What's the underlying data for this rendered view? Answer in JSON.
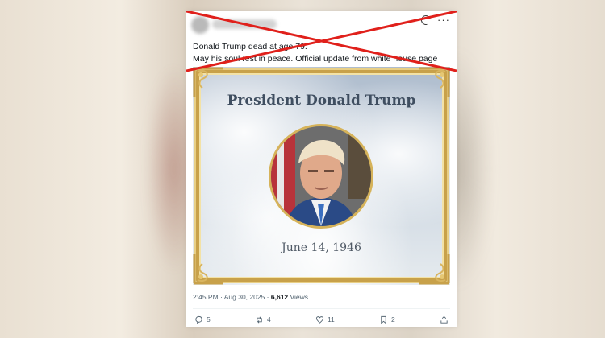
{
  "tweet": {
    "text_line1": "Donald Trump dead at age 79.",
    "text_line2": "May his soul rest in peace. Official update from white house page",
    "timestamp": "2:45 PM · Aug 30, 2025 · ",
    "views_count": "6,612",
    "views_label": "Views"
  },
  "memorial": {
    "title": "President Donald Trump",
    "date": "June 14, 1946"
  },
  "actions": {
    "replies": "5",
    "reposts": "4",
    "likes": "11",
    "bookmarks": "2"
  },
  "colors": {
    "cross_out": "#e0201b",
    "gold_frame": "#c8a14a",
    "title_text": "#3f4e60"
  },
  "icons": [
    "grok-icon",
    "more-icon",
    "reply-icon",
    "repost-icon",
    "like-icon",
    "bookmark-icon",
    "share-icon"
  ]
}
